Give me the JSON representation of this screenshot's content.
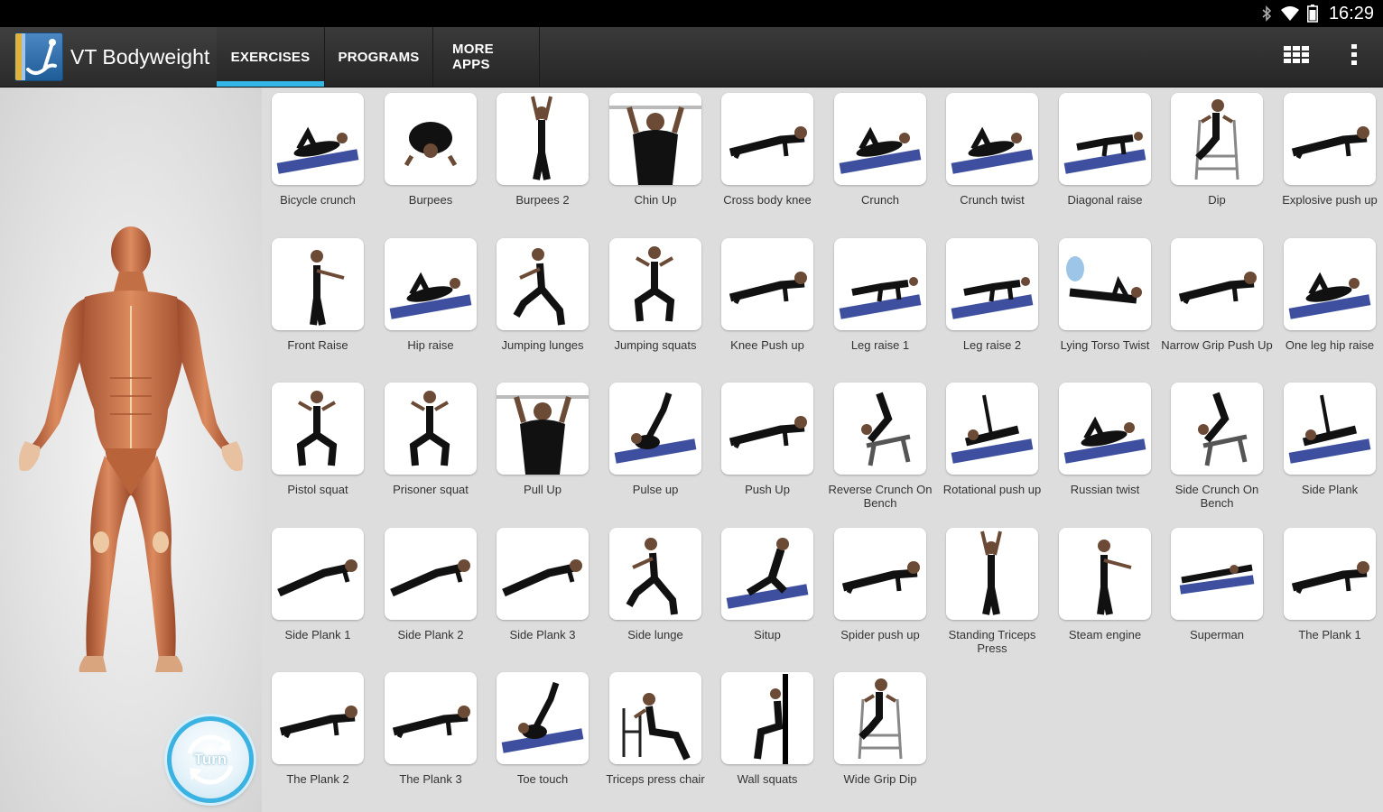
{
  "status_bar": {
    "time": "16:29",
    "icons": [
      "bluetooth-icon",
      "wifi-icon",
      "battery-icon"
    ]
  },
  "app": {
    "title": "VT Bodyweight"
  },
  "tabs": [
    {
      "label": "EXERCISES",
      "active": true
    },
    {
      "label": "PROGRAMS",
      "active": false
    },
    {
      "label": "MORE APPS",
      "active": false
    }
  ],
  "actions": {
    "grid_view": "grid-view-icon",
    "overflow": "overflow-menu-icon"
  },
  "turn_button": {
    "label": "Turn"
  },
  "accent_color": "#33b5e5",
  "exercises": [
    {
      "name": "Bicycle crunch",
      "pose": "mat-lying"
    },
    {
      "name": "Burpees",
      "pose": "prone"
    },
    {
      "name": "Burpees 2",
      "pose": "standing-arms-up"
    },
    {
      "name": "Chin Up",
      "pose": "bar-hang"
    },
    {
      "name": "Cross body knee",
      "pose": "plank"
    },
    {
      "name": "Crunch",
      "pose": "mat-lying"
    },
    {
      "name": "Crunch twist",
      "pose": "mat-lying"
    },
    {
      "name": "Diagonal raise",
      "pose": "mat-kneel"
    },
    {
      "name": "Dip",
      "pose": "dip-station"
    },
    {
      "name": "Explosive push up",
      "pose": "plank"
    },
    {
      "name": "Front Raise",
      "pose": "standing"
    },
    {
      "name": "Hip raise",
      "pose": "mat-lying"
    },
    {
      "name": "Jumping lunges",
      "pose": "lunge"
    },
    {
      "name": "Jumping squats",
      "pose": "squat"
    },
    {
      "name": "Knee Push up",
      "pose": "plank"
    },
    {
      "name": "Leg raise 1",
      "pose": "mat-kneel"
    },
    {
      "name": "Leg raise 2",
      "pose": "mat-kneel"
    },
    {
      "name": "Lying Torso Twist",
      "pose": "lying"
    },
    {
      "name": "Narrow Grip Push Up",
      "pose": "plank"
    },
    {
      "name": "One leg hip raise",
      "pose": "mat-lying"
    },
    {
      "name": "Pistol squat",
      "pose": "squat"
    },
    {
      "name": "Prisoner squat",
      "pose": "squat"
    },
    {
      "name": "Pull Up",
      "pose": "bar-hang"
    },
    {
      "name": "Pulse up",
      "pose": "mat-legs-up"
    },
    {
      "name": "Push Up",
      "pose": "plank"
    },
    {
      "name": "Reverse Crunch On Bench",
      "pose": "bench"
    },
    {
      "name": "Rotational push up",
      "pose": "mat-side"
    },
    {
      "name": "Russian twist",
      "pose": "mat-lying"
    },
    {
      "name": "Side Crunch On Bench",
      "pose": "bench"
    },
    {
      "name": "Side Plank",
      "pose": "mat-side"
    },
    {
      "name": "Side Plank 1",
      "pose": "side-plank"
    },
    {
      "name": "Side Plank 2",
      "pose": "side-plank"
    },
    {
      "name": "Side Plank 3",
      "pose": "side-plank"
    },
    {
      "name": "Side lunge",
      "pose": "lunge"
    },
    {
      "name": "Situp",
      "pose": "mat-sit"
    },
    {
      "name": "Spider push up",
      "pose": "plank"
    },
    {
      "name": "Standing Triceps Press",
      "pose": "standing-arms-up"
    },
    {
      "name": "Steam engine",
      "pose": "standing"
    },
    {
      "name": "Superman",
      "pose": "mat-prone"
    },
    {
      "name": "The Plank 1",
      "pose": "plank"
    },
    {
      "name": "The Plank 2",
      "pose": "plank"
    },
    {
      "name": "The Plank 3",
      "pose": "plank"
    },
    {
      "name": "Toe touch",
      "pose": "mat-legs-up"
    },
    {
      "name": "Triceps press chair",
      "pose": "chair"
    },
    {
      "name": "Wall squats",
      "pose": "wall"
    },
    {
      "name": "Wide Grip Dip",
      "pose": "dip-station"
    }
  ]
}
